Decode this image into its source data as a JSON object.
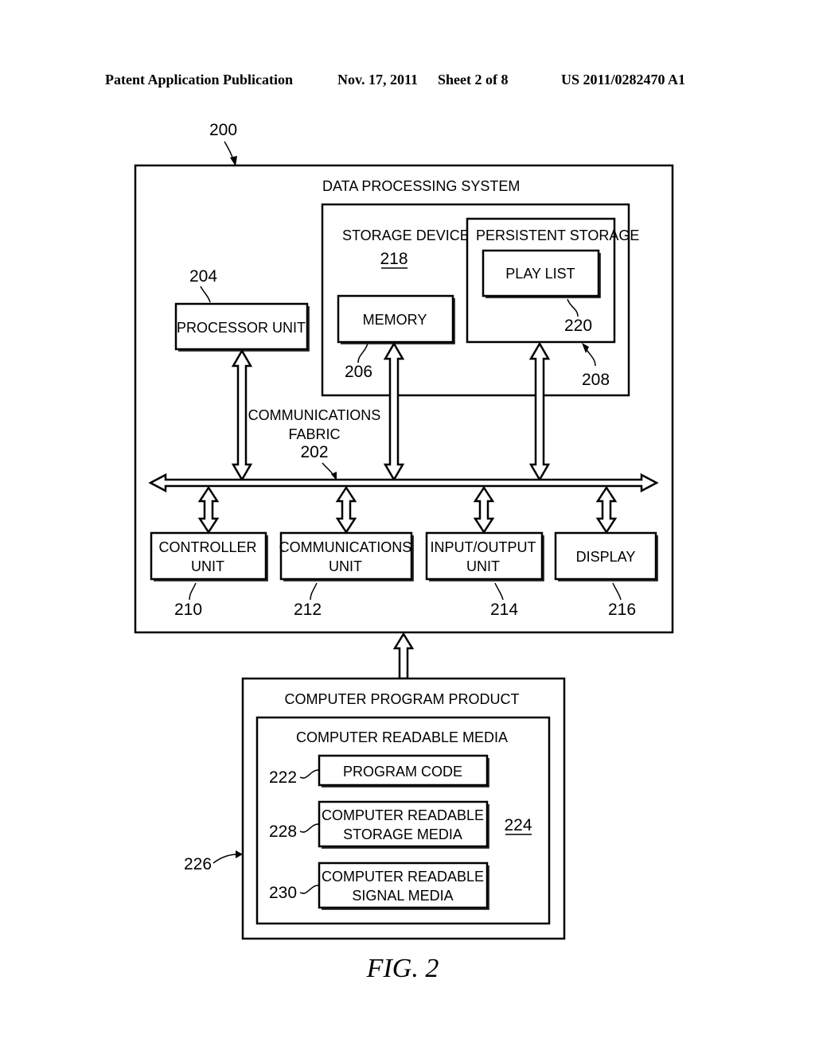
{
  "header": {
    "publication": "Patent Application Publication",
    "date": "Nov. 17, 2011",
    "sheet": "Sheet 2 of 8",
    "number": "US 2011/0282470 A1"
  },
  "diagram": {
    "ref_main": "200",
    "data_processing_system": "DATA PROCESSING SYSTEM",
    "storage_devices": {
      "label": "STORAGE DEVICES",
      "ref": "218"
    },
    "memory": {
      "label": "MEMORY",
      "ref": "206"
    },
    "persistent_storage": {
      "label": "PERSISTENT STORAGE",
      "ref": "208"
    },
    "play_list": {
      "label": "PLAY LIST",
      "ref": "220"
    },
    "processor_unit": {
      "label": "PROCESSOR UNIT",
      "ref": "204"
    },
    "communications_fabric": {
      "line1": "COMMUNICATIONS",
      "line2": "FABRIC",
      "ref": "202"
    },
    "controller_unit": {
      "line1": "CONTROLLER",
      "line2": "UNIT",
      "ref": "210"
    },
    "communications_unit": {
      "line1": "COMMUNICATIONS",
      "line2": "UNIT",
      "ref": "212"
    },
    "io_unit": {
      "line1": "INPUT/OUTPUT",
      "line2": "UNIT",
      "ref": "214"
    },
    "display": {
      "label": "DISPLAY",
      "ref": "216"
    },
    "computer_program_product": {
      "label": "COMPUTER PROGRAM PRODUCT",
      "ref": "226"
    },
    "computer_readable_media": {
      "label": "COMPUTER READABLE MEDIA",
      "ref": "224"
    },
    "program_code": {
      "label": "PROGRAM CODE",
      "ref": "222"
    },
    "cr_storage_media": {
      "line1": "COMPUTER READABLE",
      "line2": "STORAGE MEDIA",
      "ref": "228"
    },
    "cr_signal_media": {
      "line1": "COMPUTER READABLE",
      "line2": "SIGNAL MEDIA",
      "ref": "230"
    },
    "figure_caption": "FIG. 2"
  }
}
